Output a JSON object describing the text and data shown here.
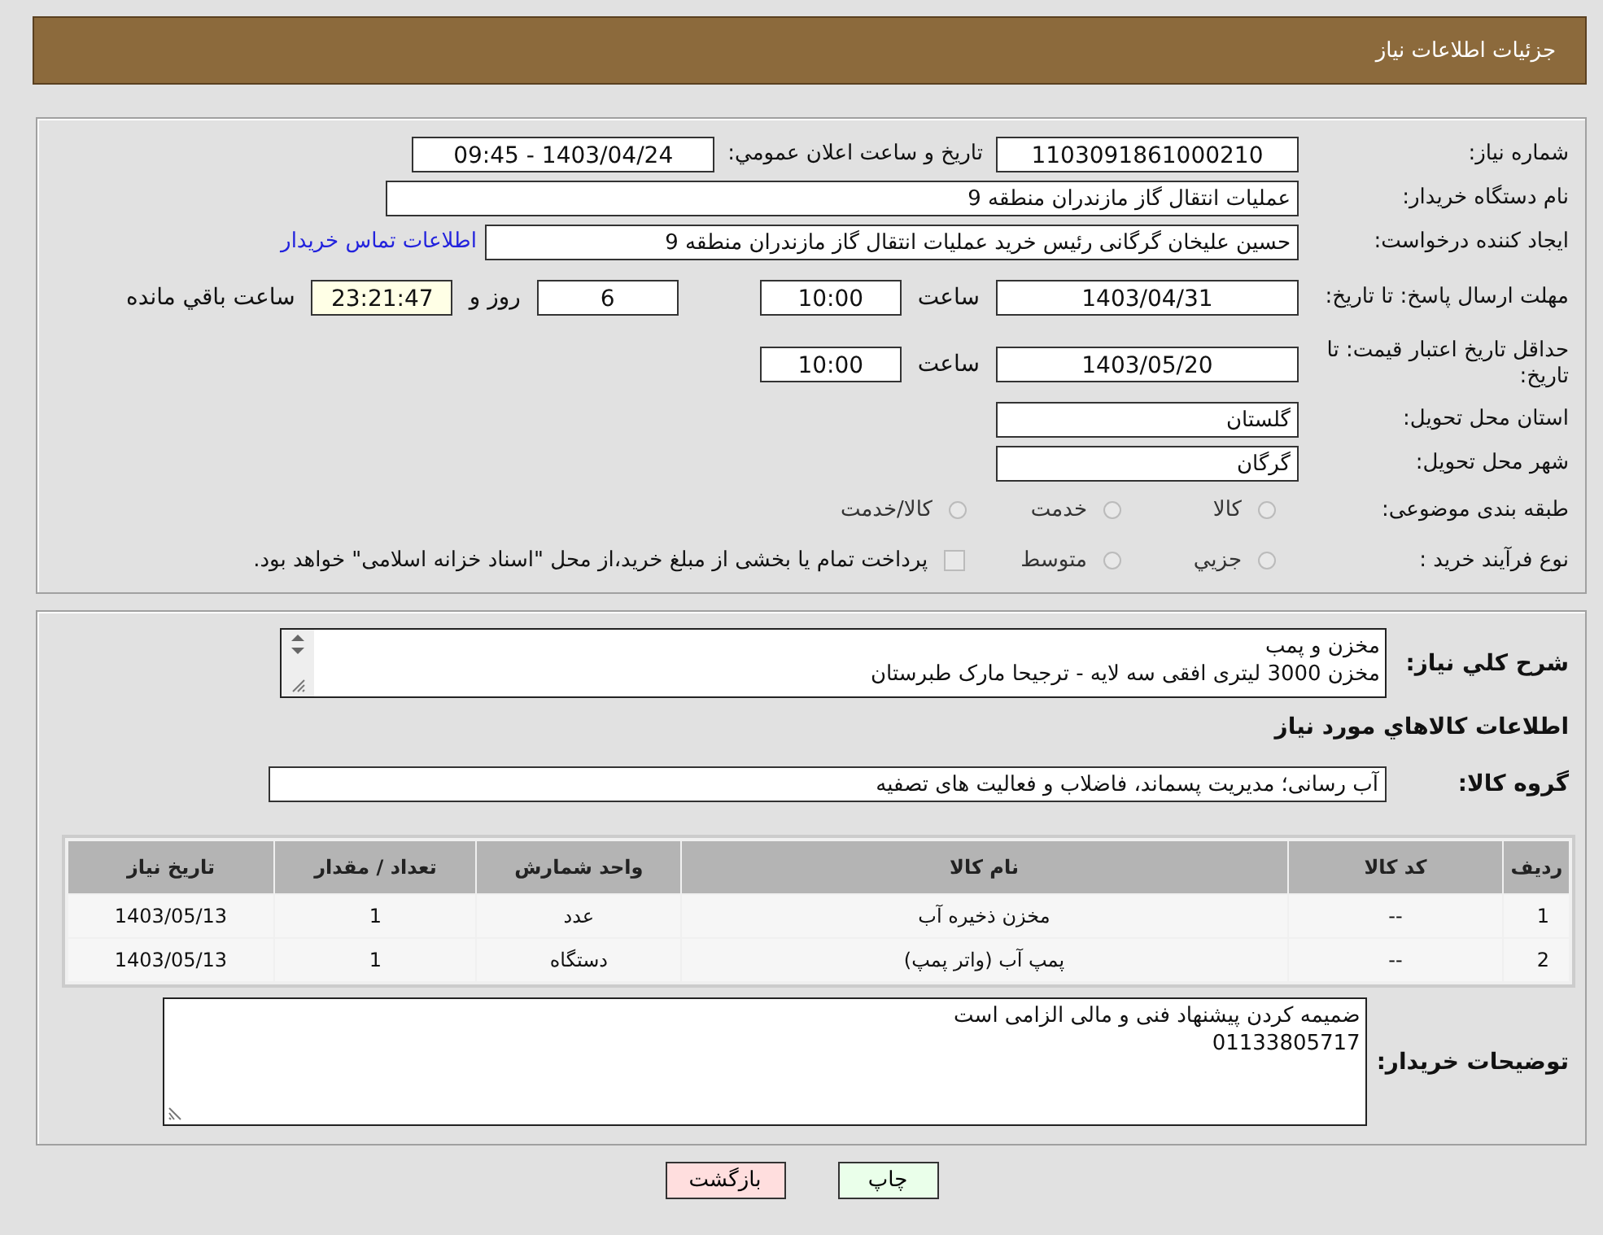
{
  "header": {
    "title": "جزئیات اطلاعات نیاز"
  },
  "need_number": {
    "label": "شماره نیاز:",
    "value": "1103091861000210"
  },
  "announce": {
    "label": "تاریخ و ساعت اعلان عمومي:",
    "value": "1403/04/24 - 09:45"
  },
  "buyer_org": {
    "label": "نام دستگاه خریدار:",
    "value": "عملیات انتقال گاز مازندران منطقه 9"
  },
  "requester": {
    "label": "ایجاد کننده درخواست:",
    "value": "حسین علیخان گرگانی رئیس خرید عملیات انتقال گاز مازندران منطقه 9",
    "link": "اطلاعات تماس خریدار"
  },
  "reply_deadline": {
    "label": "مهلت ارسال پاسخ: تا تاریخ:",
    "date": "1403/04/31",
    "time_label": "ساعت",
    "time": "10:00",
    "days": "6",
    "days_label": "روز و",
    "remaining": "23:21:47",
    "remaining_label": "ساعت باقي مانده"
  },
  "price_validity": {
    "label": "حداقل تاریخ اعتبار قیمت: تا تاریخ:",
    "date": "1403/05/20",
    "time_label": "ساعت",
    "time": "10:00"
  },
  "province": {
    "label": "استان محل تحویل:",
    "value": "گلستان"
  },
  "city": {
    "label": "شهر محل تحویل:",
    "value": "گرگان"
  },
  "category": {
    "label": "طبقه بندی موضوعی:",
    "options": [
      {
        "label": "کالا",
        "selected": false
      },
      {
        "label": "خدمت",
        "selected": false
      },
      {
        "label": "کالا/خدمت",
        "selected": false
      }
    ]
  },
  "purchase_type": {
    "label": "نوع فرآیند خرید :",
    "options": [
      {
        "label": "جزيي",
        "selected": false
      },
      {
        "label": "متوسط",
        "selected": false
      }
    ],
    "treasury": {
      "checked": false,
      "text": "پرداخت تمام یا بخشی از مبلغ خرید،از محل \"اسناد خزانه اسلامی\" خواهد بود."
    }
  },
  "description": {
    "label": "شرح کلي نیاز:",
    "lines": [
      "مخزن و پمب",
      "مخزن 3000 لیتری افقی سه لایه - ترجیحا مارک طبرستان"
    ]
  },
  "goods_heading": "اطلاعات کالاهاي مورد نیاز",
  "goods_group": {
    "label": "گروه کالا:",
    "value": "آب رسانی؛ مدیریت پسماند، فاضلاب و فعالیت های تصفیه"
  },
  "table": {
    "columns": [
      "ردیف",
      "کد کالا",
      "نام کالا",
      "واحد شمارش",
      "تعداد / مقدار",
      "تاریخ نیاز"
    ],
    "rows": [
      [
        "1",
        "--",
        "مخزن ذخیره آب",
        "عدد",
        "1",
        "1403/05/13"
      ],
      [
        "2",
        "--",
        "پمپ آب (واتر پمپ)",
        "دستگاه",
        "1",
        "1403/05/13"
      ]
    ]
  },
  "buyer_notes": {
    "label": "توضیحات خریدار:",
    "lines": [
      "ضمیمه کردن پیشنهاد فنی و مالی الزامی است",
      "01133805717"
    ]
  },
  "buttons": [
    {
      "label": "چاپ",
      "kind": "print"
    },
    {
      "label": "بازگشت",
      "kind": "back"
    }
  ]
}
